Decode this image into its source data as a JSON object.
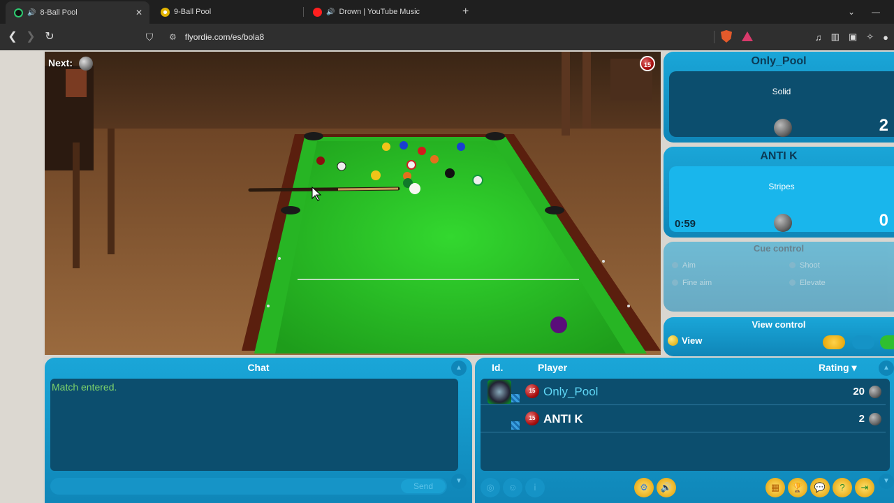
{
  "browser": {
    "tabs": [
      {
        "title": "8-Ball Pool",
        "active": true
      },
      {
        "title": "9-Ball Pool",
        "active": false
      },
      {
        "title": "Drown | YouTube Music",
        "active": false
      }
    ],
    "url": "flyordie.com/es/bola8"
  },
  "game": {
    "next_label": "Next:",
    "rack_count": "15"
  },
  "players": [
    {
      "name": "Only_Pool",
      "type": "Solid",
      "score": "2",
      "time": ""
    },
    {
      "name": "ANTI K",
      "type": "Stripes",
      "score": "0",
      "time": "0:59"
    }
  ],
  "controls": {
    "title": "Cue control",
    "options": [
      "Aim",
      "Shoot",
      "Fine aim",
      "Elevate"
    ]
  },
  "view": {
    "title": "View control",
    "option": "View"
  },
  "chat": {
    "title": "Chat",
    "messages": [
      "Match entered."
    ],
    "send_label": "Send"
  },
  "player_list": {
    "col_id": "Id.",
    "col_player": "Player",
    "col_rating": "Rating",
    "rows": [
      {
        "name": "Only_Pool",
        "rating": "20",
        "badge": "15"
      },
      {
        "name": "ANTI K",
        "rating": "2",
        "badge": "15"
      }
    ]
  },
  "colors": {
    "panel": "#1aa6d8",
    "panel_dark": "#0c4e6e",
    "felt": "#2dbf2a",
    "chat_text": "#7fd46b",
    "player1_name": "#5fd6f5"
  }
}
